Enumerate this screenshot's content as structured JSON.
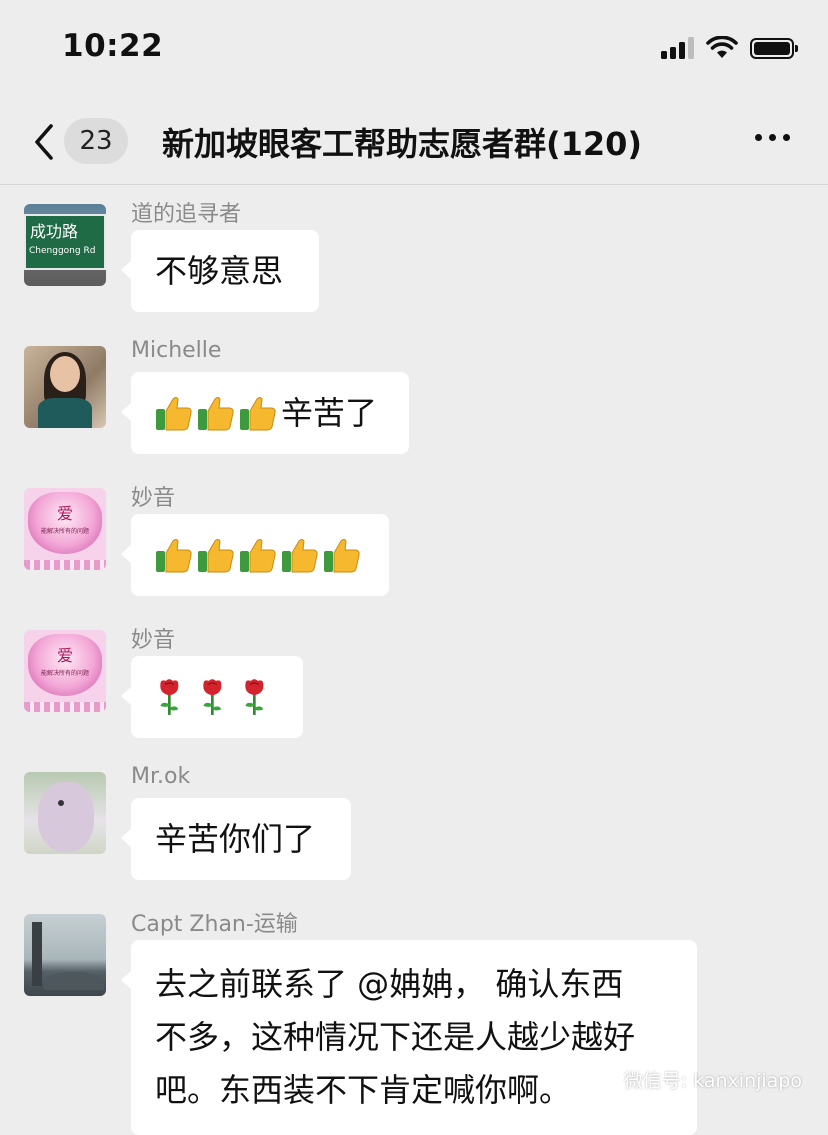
{
  "status_bar": {
    "time": "10:22"
  },
  "nav": {
    "unread_count": "23",
    "title": "新加坡眼客工帮助志愿者群(120)"
  },
  "messages": [
    {
      "sender": "道的追寻者",
      "text": "不够意思"
    },
    {
      "sender": "Michelle",
      "text": "辛苦了",
      "thumbs": 3
    },
    {
      "sender": "妙音",
      "thumbs": 5
    },
    {
      "sender": "妙音",
      "roses": 3
    },
    {
      "sender": "Mr.ok",
      "text": "辛苦你们了"
    },
    {
      "sender": "Capt Zhan-运输",
      "lines": [
        "去之前联系了 @姌姌， 确认东西",
        "不多，这种情况下还是人越少越好",
        "吧。东西装不下肯定喊你啊。"
      ]
    }
  ],
  "avatars": {
    "street_sign_line1": "成功路",
    "street_sign_line2": "Chenggong Rd",
    "heart_char": "爱",
    "heart_caption": "能解决所有的问题"
  },
  "watermark": "微信号: kanxinjiapo",
  "colors": {
    "background": "#ededed",
    "bubble": "#ffffff",
    "sender_name": "#8a8a8a"
  }
}
